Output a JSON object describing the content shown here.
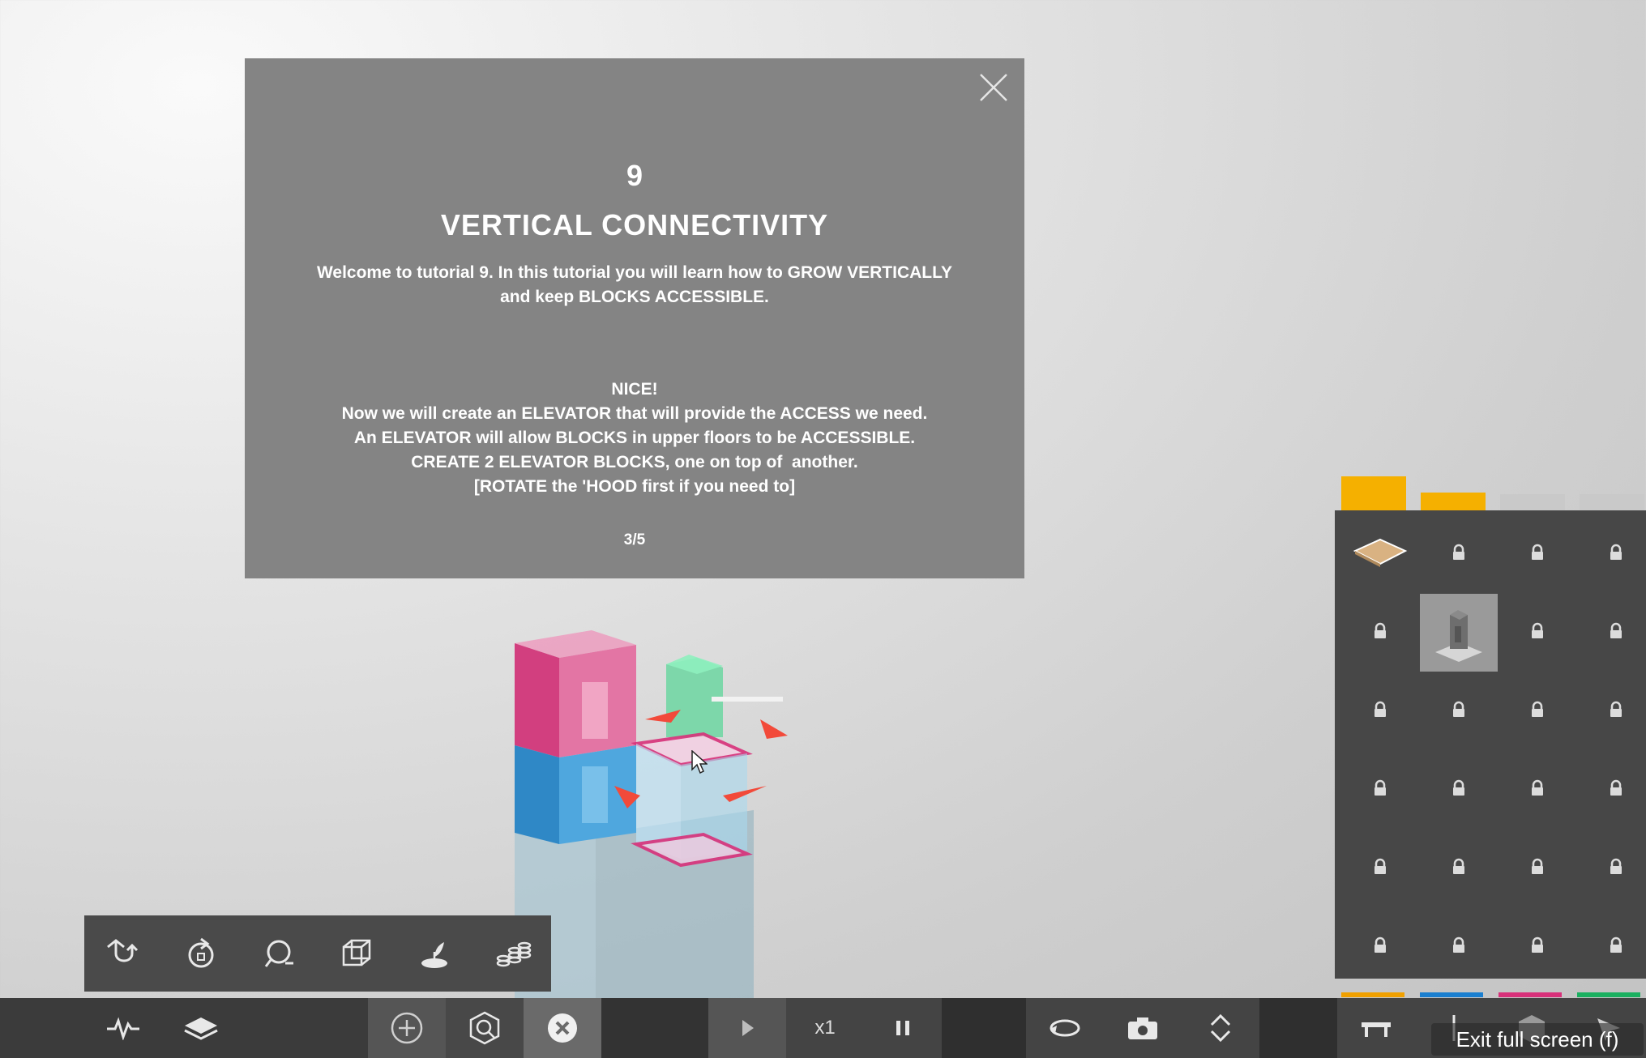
{
  "tutorial": {
    "number": "9",
    "title": "VERTICAL CONNECTIVITY",
    "intro_line1": "Welcome to tutorial 9. In this tutorial you will learn how to GROW VERTICALLY",
    "intro_line2": "and keep BLOCKS ACCESSIBLE.",
    "body_lines": [
      "NICE!",
      "Now we will create an ELEVATOR that will provide the ACCESS we need.",
      "An ELEVATOR will allow BLOCKS in upper floors to be ACCESSIBLE.",
      "CREATE 2 ELEVATOR BLOCKS, one on top of  another.",
      "[ROTATE the 'HOOD first if you need to]"
    ],
    "page": "3/5"
  },
  "toolbar": {
    "tools": [
      "move-tool-icon",
      "rotate-tool-icon",
      "lasso-tool-icon",
      "wireframe-cube-icon",
      "plant-icon",
      "coins-icon"
    ]
  },
  "bottombar": {
    "speed_label": "x1"
  },
  "block_panel": {
    "tabs": [
      {
        "color": "#f5b000",
        "active": true
      },
      {
        "color": "#f5b000",
        "active": false
      },
      {
        "color": "#c9c9c9",
        "active": false
      },
      {
        "color": "#c9c9c9",
        "active": false
      }
    ],
    "color_strip": [
      "#f0a000",
      "#1a7fd0",
      "#d8317a",
      "#1bb060"
    ]
  },
  "overlay": {
    "exit_fullscreen": "Exit full screen (f)"
  },
  "colors": {
    "modal_bg": "#848484",
    "pink_block": "#d23f7f",
    "blue_block": "#3f9fd8",
    "green_block": "#5ed59a",
    "arrow_red": "#f24a3a"
  }
}
